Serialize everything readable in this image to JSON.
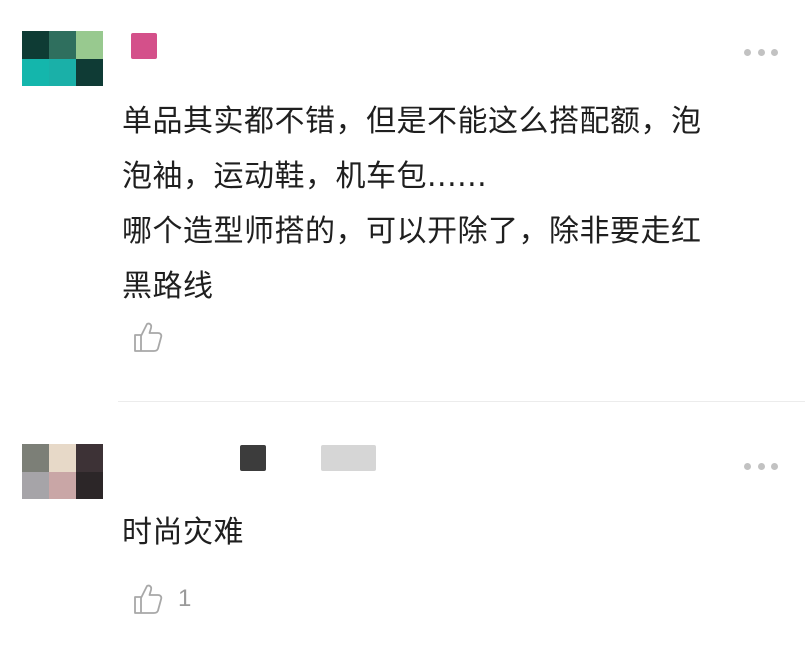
{
  "colors": {
    "text": "#1f1f1f",
    "muted": "#9a9a9a",
    "dots": "#c2c2c2",
    "divider": "#ececec"
  },
  "comments": [
    {
      "avatar": {
        "colors": [
          "#0e3b34",
          "#2f6f5e",
          "#98c98f",
          "#14b6ac",
          "#1ab0a8",
          "#0f3b35"
        ]
      },
      "name_blur_colors": [
        "#d4508a"
      ],
      "more_icon": "more-horizontal-icon",
      "lines": [
        "单品其实都不错，但是不能这么搭配额，泡",
        "泡袖，运动鞋，机车包......",
        "哪个造型师搭的，可以开除了，除非要走红",
        "黑路线"
      ],
      "like_icon": "thumbs-up-icon",
      "like_count": ""
    },
    {
      "avatar": {
        "colors": [
          "#7c7f77",
          "#e7d9c8",
          "#3d3236",
          "#a6a4a8",
          "#c9a6a6",
          "#2c2628"
        ]
      },
      "name_blur_colors": [
        "#3c3c3c",
        "#d6d6d6"
      ],
      "more_icon": "more-horizontal-icon",
      "lines": [
        "时尚灾难"
      ],
      "like_icon": "thumbs-up-icon",
      "like_count": "1"
    }
  ]
}
